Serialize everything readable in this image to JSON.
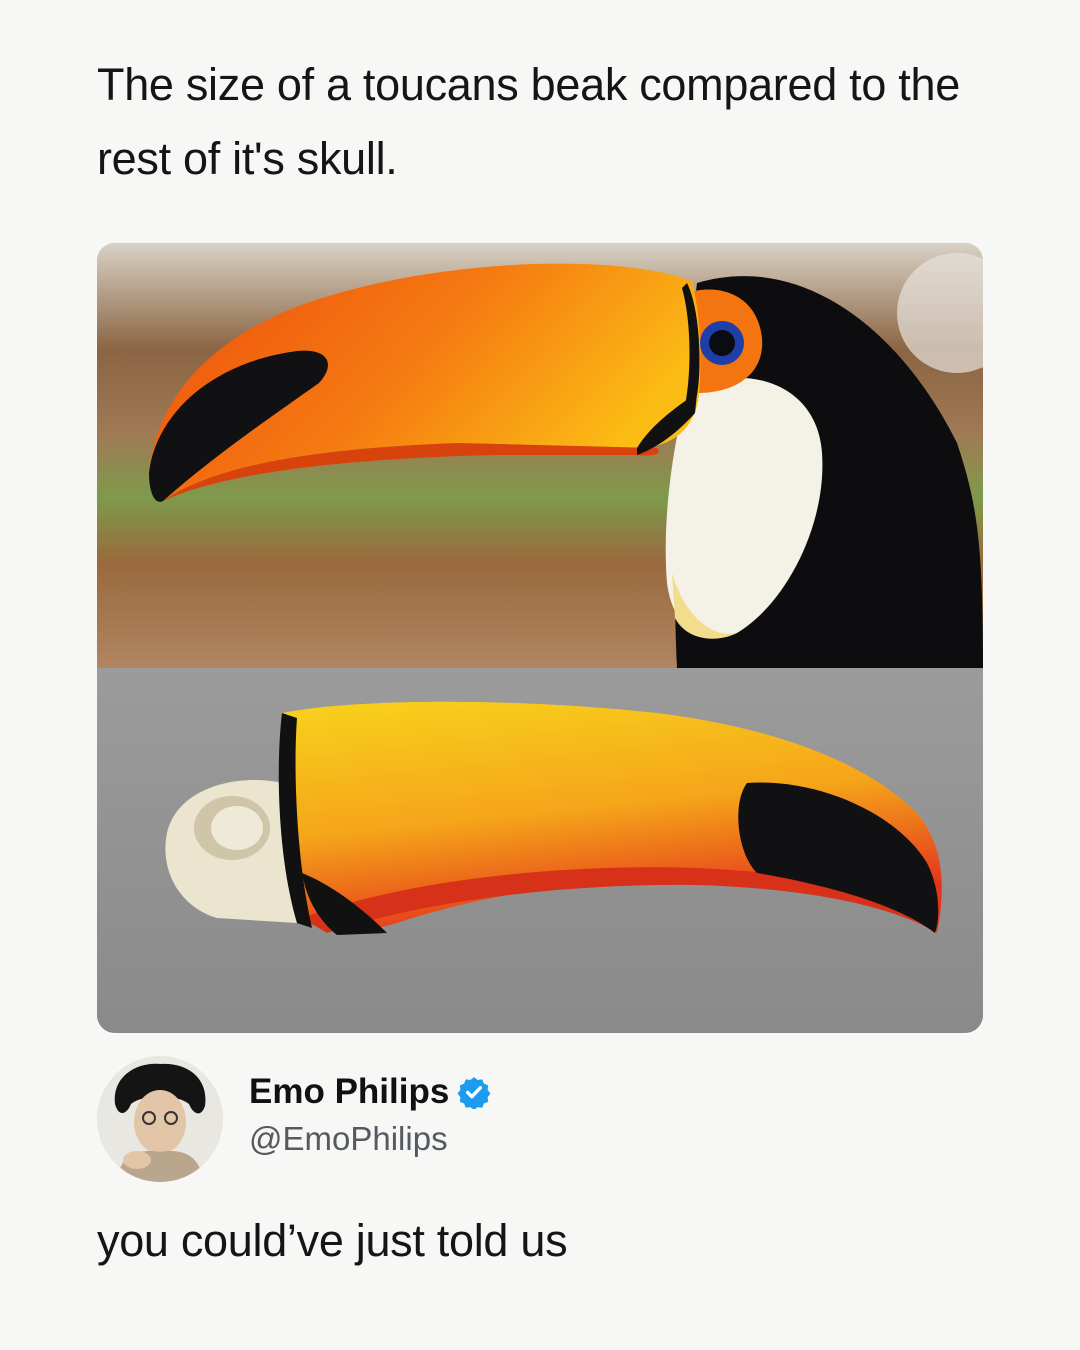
{
  "post": {
    "caption": "The size of a toucans beak compared to the rest of it's skull."
  },
  "media": {
    "top_photo": "toucan-head-photo",
    "bottom_photo": "toucan-skull-photo"
  },
  "author": {
    "name": "Emo Philips",
    "handle": "@EmoPhilips",
    "verified_icon": "verified-badge-icon",
    "verified_color": "#1d9bf0"
  },
  "reply": {
    "text": "you could’ve just told us"
  },
  "colors": {
    "background": "#f7f7f6",
    "beak_orange": "#f25a0f",
    "beak_yellow": "#f7c21a"
  }
}
